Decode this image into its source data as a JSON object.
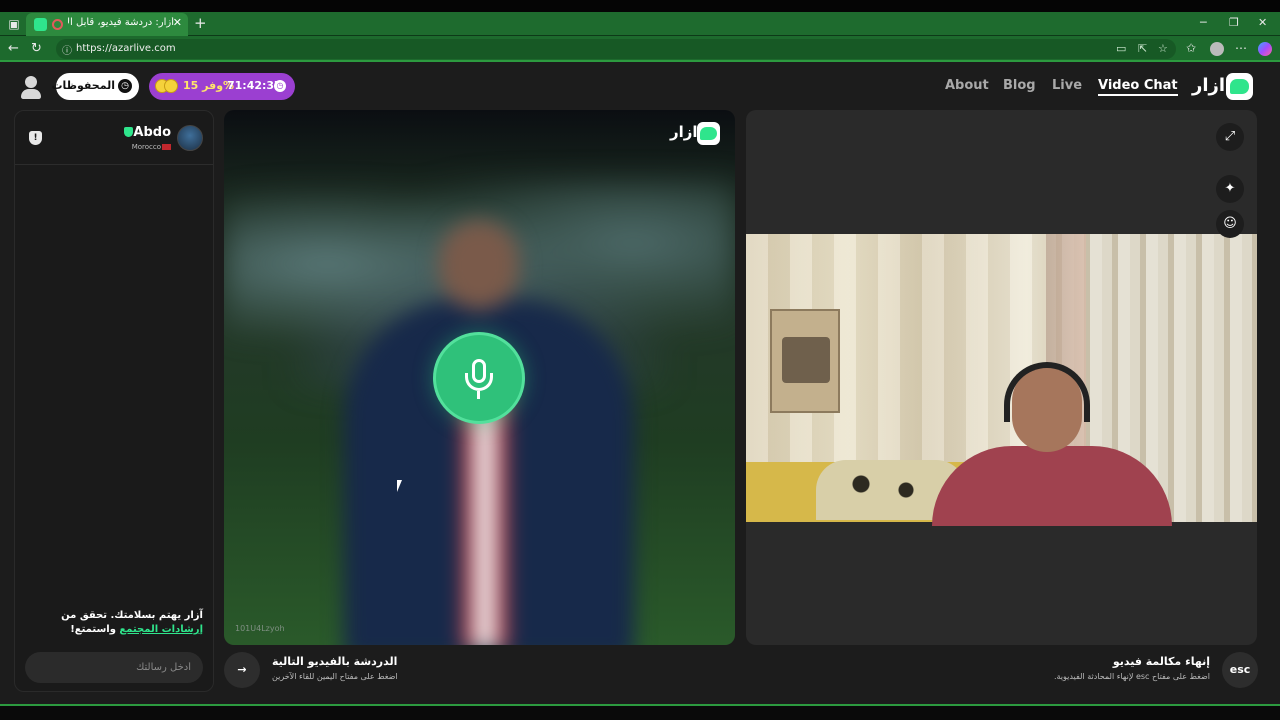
{
  "browser": {
    "tab_title": "أزار: دردشة فيديو، قابل الأصدقاء",
    "url": "https://azarlive.com"
  },
  "header": {
    "saved_label": "المحفوظات",
    "promo_discount": "وفر 15%",
    "promo_timer": "71:42:37",
    "nav": [
      "About",
      "Blog",
      "Live",
      "Video Chat"
    ],
    "active_nav": "Video Chat",
    "brand": "ازار"
  },
  "chat": {
    "partner_name": "Abdo",
    "partner_country": "Morocco",
    "notice_prefix": "آزار يهتم بسلامتك. تحقق من ",
    "notice_link": "إرشادات المجتمع",
    "notice_suffix": " واستمتع!",
    "input_placeholder": "أدخل رسالتك"
  },
  "partner_video": {
    "brand": "ازار",
    "watermark": "101U4Lzyoh"
  },
  "controls": {
    "next_title": "الدردشة بالفيديو التالية",
    "next_subtitle": "اضغط على مفتاح اليمين للقاء الآخرين",
    "end_title": "إنهاء مكالمة فيديو",
    "end_subtitle": "اضغط على مفتاح esc لإنهاء المحادثة الفيديوية.",
    "esc_label": "esc"
  },
  "colors": {
    "accent": "#2fe58c",
    "promo": "#9b3fd1",
    "browser_green": "#1e6b2e"
  }
}
